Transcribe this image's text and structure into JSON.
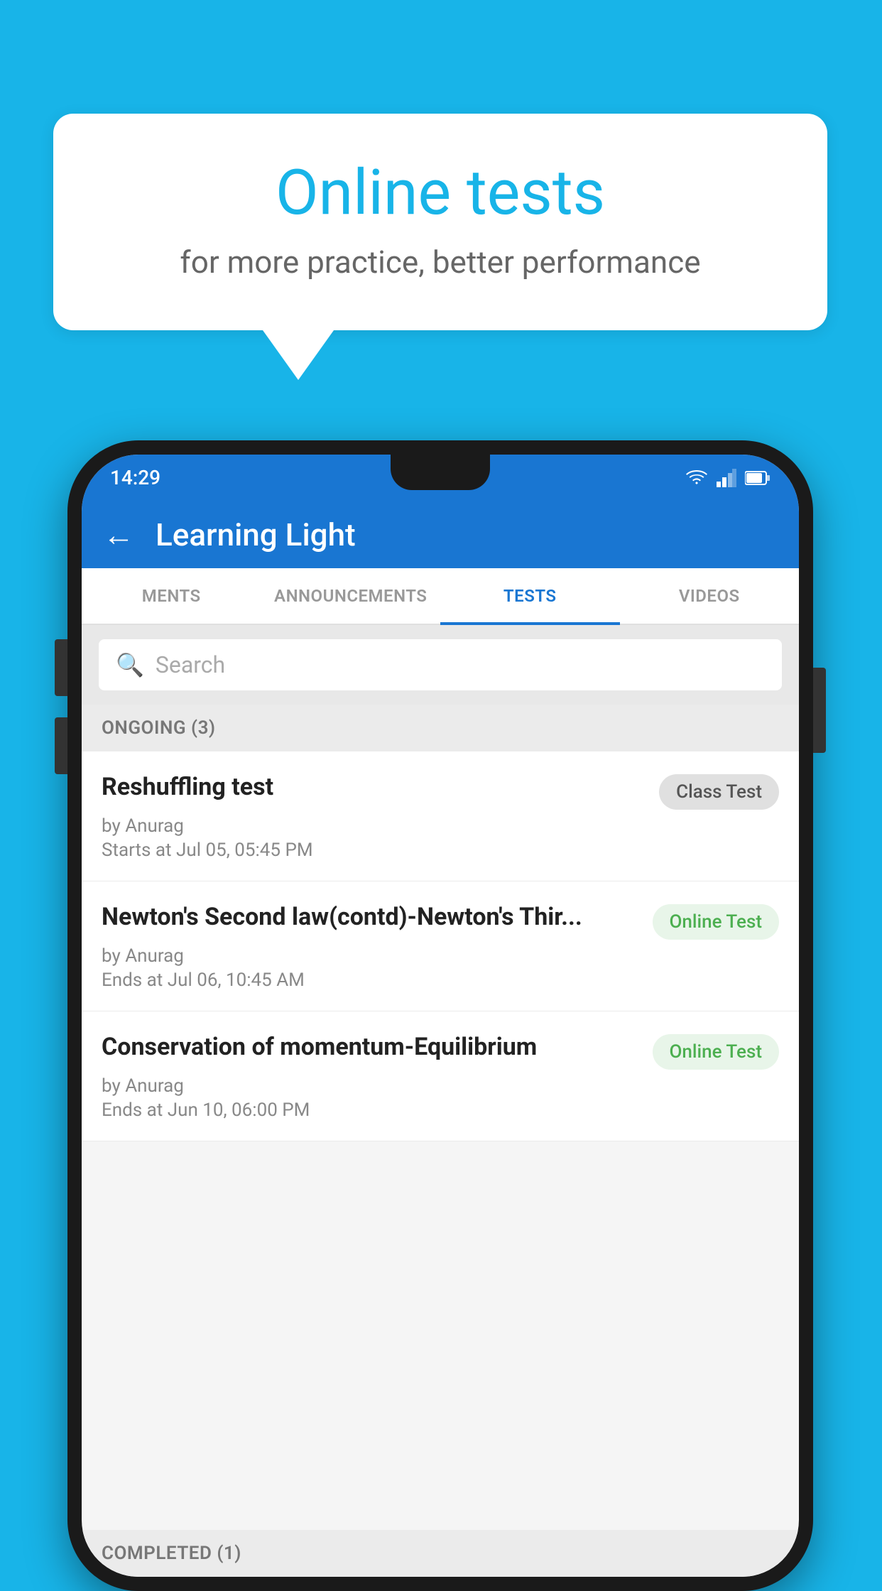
{
  "background": {
    "color": "#18b4e8"
  },
  "speech_bubble": {
    "title": "Online tests",
    "subtitle": "for more practice, better performance"
  },
  "phone": {
    "status_bar": {
      "time": "14:29",
      "icons": [
        "wifi",
        "signal",
        "battery"
      ]
    },
    "app_bar": {
      "title": "Learning Light",
      "back_label": "←"
    },
    "tabs": [
      {
        "label": "MENTS",
        "active": false
      },
      {
        "label": "ANNOUNCEMENTS",
        "active": false
      },
      {
        "label": "TESTS",
        "active": true
      },
      {
        "label": "VIDEOS",
        "active": false
      }
    ],
    "search": {
      "placeholder": "Search"
    },
    "ongoing_section": {
      "label": "ONGOING (3)"
    },
    "tests": [
      {
        "title": "Reshuffling test",
        "badge": "Class Test",
        "badge_type": "class",
        "by": "by Anurag",
        "date_label": "Starts at",
        "date": "Jul 05, 05:45 PM"
      },
      {
        "title": "Newton's Second law(contd)-Newton's Thir...",
        "badge": "Online Test",
        "badge_type": "online",
        "by": "by Anurag",
        "date_label": "Ends at",
        "date": "Jul 06, 10:45 AM"
      },
      {
        "title": "Conservation of momentum-Equilibrium",
        "badge": "Online Test",
        "badge_type": "online",
        "by": "by Anurag",
        "date_label": "Ends at",
        "date": "Jun 10, 06:00 PM"
      }
    ],
    "completed_section": {
      "label": "COMPLETED (1)"
    }
  }
}
